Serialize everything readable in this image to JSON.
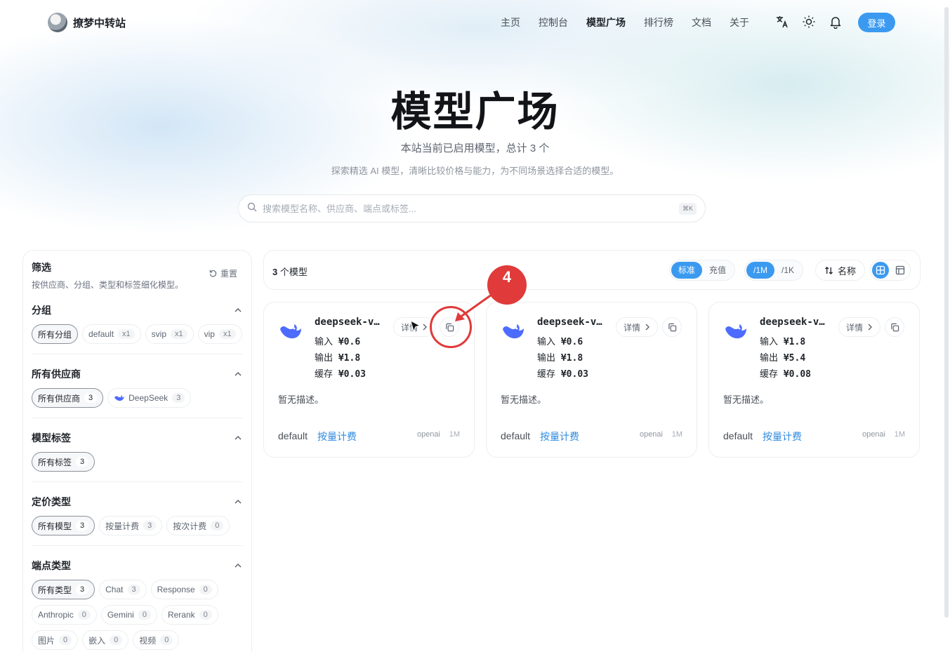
{
  "brand": {
    "name": "撩梦中转站"
  },
  "nav": [
    {
      "label": "主页",
      "active": false
    },
    {
      "label": "控制台",
      "active": false
    },
    {
      "label": "模型广场",
      "active": true
    },
    {
      "label": "排行榜",
      "active": false
    },
    {
      "label": "文档",
      "active": false
    },
    {
      "label": "关于",
      "active": false
    }
  ],
  "header": {
    "login_label": "登录",
    "icons": [
      "translate-icon",
      "sun-icon",
      "bell-icon"
    ]
  },
  "hero": {
    "title": "模型广场",
    "subtitle": "本站当前已启用模型，总计 3 个",
    "description": "探索精选 AI 模型，清晰比较价格与能力，为不同场景选择合适的模型。"
  },
  "search": {
    "placeholder": "搜索模型名称、供应商、端点或标签...",
    "shortcut": "⌘K"
  },
  "filter": {
    "title": "筛选",
    "description": "按供应商、分组、类型和标签细化模型。",
    "reset_label": "重置",
    "sections": {
      "group": {
        "title": "分组",
        "chips": [
          {
            "label": "所有分组",
            "count": "",
            "selected": true
          },
          {
            "label": "default",
            "count": "x1",
            "selected": false
          },
          {
            "label": "svip",
            "count": "x1",
            "selected": false
          },
          {
            "label": "vip",
            "count": "x1",
            "selected": false
          }
        ]
      },
      "provider": {
        "title": "所有供应商",
        "chips": [
          {
            "label": "所有供应商",
            "count": "3",
            "selected": true
          },
          {
            "label": "DeepSeek",
            "count": "3",
            "selected": false
          }
        ]
      },
      "tags": {
        "title": "模型标签",
        "chips": [
          {
            "label": "所有标签",
            "count": "3",
            "selected": true
          }
        ]
      },
      "pricing": {
        "title": "定价类型",
        "chips": [
          {
            "label": "所有模型",
            "count": "3",
            "selected": true
          },
          {
            "label": "按量计费",
            "count": "3",
            "selected": false
          },
          {
            "label": "按次计费",
            "count": "0",
            "selected": false
          }
        ]
      },
      "endpoint": {
        "title": "端点类型",
        "chips": [
          {
            "label": "所有类型",
            "count": "3",
            "selected": true
          },
          {
            "label": "Chat",
            "count": "3",
            "selected": false
          },
          {
            "label": "Response",
            "count": "0",
            "selected": false
          },
          {
            "label": "Anthropic",
            "count": "0",
            "selected": false
          },
          {
            "label": "Gemini",
            "count": "0",
            "selected": false
          },
          {
            "label": "Rerank",
            "count": "0",
            "selected": false
          },
          {
            "label": "图片",
            "count": "0",
            "selected": false
          },
          {
            "label": "嵌入",
            "count": "0",
            "selected": false
          },
          {
            "label": "视频",
            "count": "0",
            "selected": false
          }
        ]
      }
    }
  },
  "toolbar": {
    "count_number": "3",
    "count_suffix": " 个模型",
    "price_mode": [
      "标准",
      "充值"
    ],
    "unit_mode": [
      "/1M",
      "/1K"
    ],
    "sort_label": "名称"
  },
  "cards": [
    {
      "name": "deepseek-v...",
      "input": "¥0.6",
      "output": "¥1.8",
      "cache": "¥0.03",
      "description": "暂无描述。",
      "group": "default",
      "billing": "按量计费",
      "endpoint": "openai",
      "unit": "1M",
      "detail_label": "详情"
    },
    {
      "name": "deepseek-v...",
      "input": "¥0.6",
      "output": "¥1.8",
      "cache": "¥0.03",
      "description": "暂无描述。",
      "group": "default",
      "billing": "按量计费",
      "endpoint": "openai",
      "unit": "1M",
      "detail_label": "详情"
    },
    {
      "name": "deepseek-v...",
      "input": "¥1.8",
      "output": "¥5.4",
      "cache": "¥0.08",
      "description": "暂无描述。",
      "group": "default",
      "billing": "按量计费",
      "endpoint": "openai",
      "unit": "1M",
      "detail_label": "详情"
    }
  ],
  "price_labels": {
    "input": "输入",
    "output": "输出",
    "cache": "缓存"
  },
  "annotation": {
    "step": "4",
    "color": "#e03a3a"
  },
  "colors": {
    "accent": "#3b9af0",
    "link": "#2f8ae0",
    "annotation": "#e03a3a"
  }
}
